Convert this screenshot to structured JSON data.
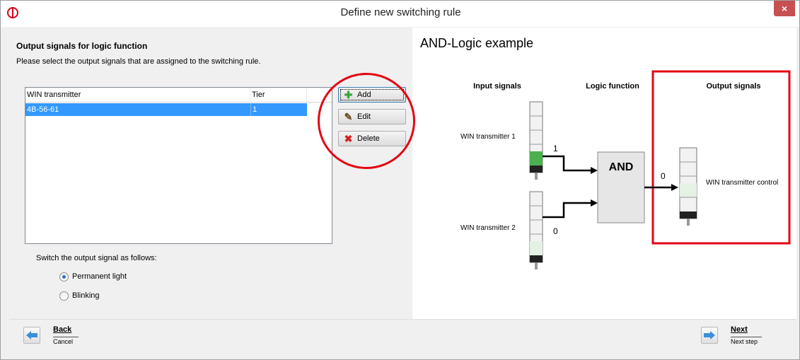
{
  "window": {
    "title": "Define new switching rule",
    "close_glyph": "×"
  },
  "left": {
    "section_title": "Output signals for logic function",
    "section_desc": "Please select the output signals that are assigned to the switching rule.",
    "table": {
      "columns": [
        "WIN transmitter",
        "Tier"
      ],
      "rows": [
        {
          "transmitter": "4B-56-61",
          "tier": "1",
          "selected": true
        }
      ]
    },
    "buttons": {
      "add": "Add",
      "edit": "Edit",
      "delete": "Delete"
    },
    "switch_label": "Switch the output signal as follows:",
    "options": {
      "permanent": "Permanent light",
      "blinking": "Blinking",
      "selected": "permanent"
    }
  },
  "example": {
    "title": "AND-Logic example",
    "headers": {
      "input": "Input signals",
      "logic": "Logic function",
      "output": "Output signals"
    },
    "transmitter_1": "WIN transmitter 1",
    "transmitter_2": "WIN transmitter 2",
    "value_1": "1",
    "value_2": "0",
    "and_label": "AND",
    "output_value": "0",
    "output_label": "WIN transmitter control"
  },
  "footer": {
    "back": "Back",
    "cancel": "Cancel",
    "next": "Next",
    "next_step": "Next step"
  },
  "colors": {
    "highlight_red": "#e30613",
    "selection_blue": "#3399ff",
    "light_green": "#4caf50"
  }
}
